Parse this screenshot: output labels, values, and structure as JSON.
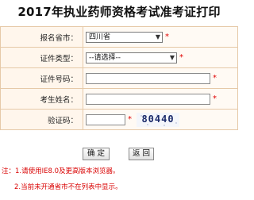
{
  "title": "2017年执业药师资格考试准考证打印",
  "form": {
    "province_label": "报名省市：",
    "province_value": "四川省",
    "id_type_label": "证件类型：",
    "id_type_value": "--请选择--",
    "id_number_label": "证件号码：",
    "name_label": "考生姓名：",
    "captcha_label": "验证码：",
    "captcha_value": "80440",
    "required_mark": "*"
  },
  "buttons": {
    "confirm": "确 定",
    "back": "返 回"
  },
  "notes": [
    "注：1.请使用IE8.0及更高版本浏览器。",
    "2.当前未开通省市不在列表中显示。"
  ],
  "colors": {
    "row_background": "#fff6ec",
    "border": "#e6c9a8",
    "required": "#e00000",
    "notes_text": "#d90000"
  }
}
